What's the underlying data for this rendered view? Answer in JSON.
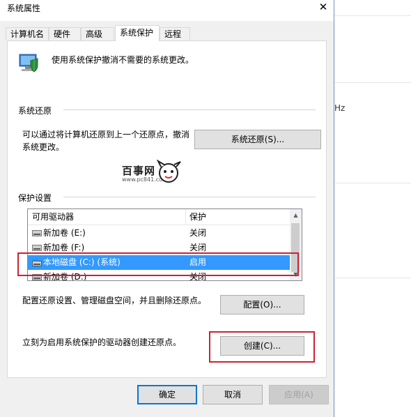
{
  "dialog": {
    "title": "系统属性",
    "close_glyph": "✕"
  },
  "tabs": [
    {
      "label": "计算机名",
      "active": false
    },
    {
      "label": "硬件",
      "active": false
    },
    {
      "label": "高级",
      "active": false
    },
    {
      "label": "系统保护",
      "active": true
    },
    {
      "label": "远程",
      "active": false
    }
  ],
  "intro": {
    "text": "使用系统保护撤消不需要的系统更改。",
    "icon": "shield-computer-icon"
  },
  "restore": {
    "section_title": "系统还原",
    "description_line1": "可以通过将计算机还原到上一个还原点，撤消",
    "description_line2": "系统更改。",
    "button_label": "系统还原(S)..."
  },
  "watermark": {
    "text": "百事网",
    "url": "www.pc841.com"
  },
  "protection": {
    "section_title": "保护设置",
    "columns": [
      "可用驱动器",
      "保护"
    ],
    "drives": [
      {
        "name": "新加卷 (E:)",
        "protection": "关闭",
        "selected": false,
        "icon": "drive-icon"
      },
      {
        "name": "新加卷 (F:)",
        "protection": "关闭",
        "selected": false,
        "icon": "drive-icon"
      },
      {
        "name": "本地磁盘 (C:) (系统)",
        "protection": "启用",
        "selected": true,
        "icon": "system-drive-icon"
      },
      {
        "name": "新加卷 (D:)",
        "protection": "关闭",
        "selected": false,
        "icon": "drive-icon"
      }
    ],
    "configure_text": "配置还原设置、管理磁盘空间，并且删除还原点。",
    "configure_button": "配置(O)...",
    "create_text": "立刻为启用系统保护的驱动器创建还原点。",
    "create_button": "创建(C)..."
  },
  "footer": {
    "ok": "确定",
    "cancel": "取消",
    "apply": "应用(A)"
  },
  "background_window": {
    "fragment": "Hz"
  },
  "colors": {
    "selection": "#3399ff",
    "annotation_red": "#cc2233",
    "dialog_bg": "#f0f0f0",
    "primary_border": "#0078d7"
  }
}
